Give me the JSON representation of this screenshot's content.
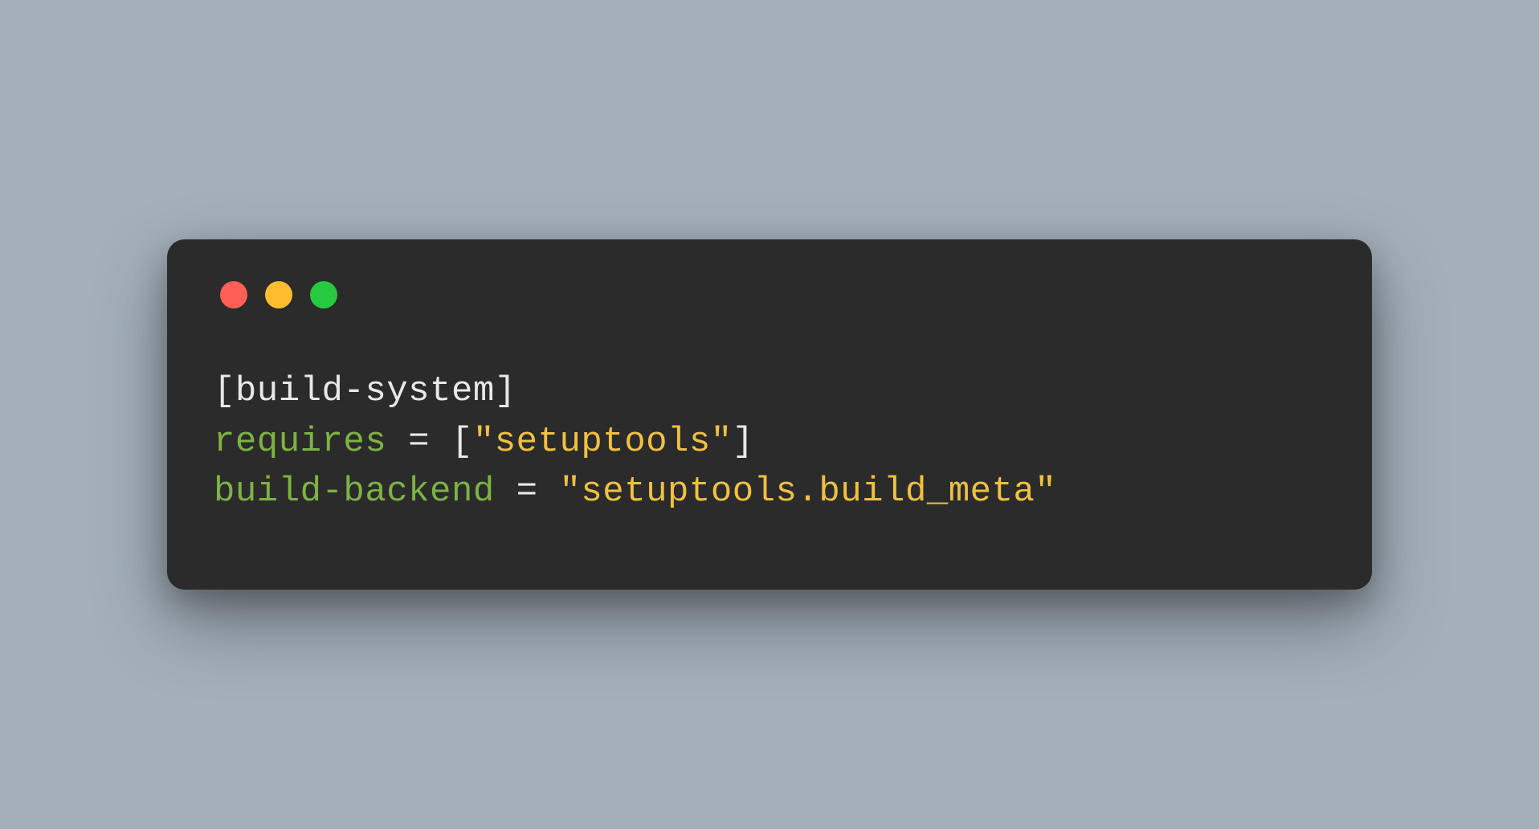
{
  "colors": {
    "background": "#a4afba",
    "window": "#2b2b2b",
    "trafficRed": "#ff5f56",
    "trafficYellow": "#ffbd2e",
    "trafficGreen": "#27c93f",
    "section": "#e8e8e8",
    "key": "#7cb342",
    "punct": "#e8e8e8",
    "string": "#f0c040"
  },
  "code": {
    "language": "toml",
    "tokens": {
      "l1_section": "[build-system]",
      "l2_key": "requires",
      "l2_eq": " = ",
      "l2_lb": "[",
      "l2_str": "\"setuptools\"",
      "l2_rb": "]",
      "l3_key": "build-backend",
      "l3_eq": " = ",
      "l3_str": "\"setuptools.build_meta\""
    },
    "raw": "[build-system]\nrequires = [\"setuptools\"]\nbuild-backend = \"setuptools.build_meta\""
  }
}
